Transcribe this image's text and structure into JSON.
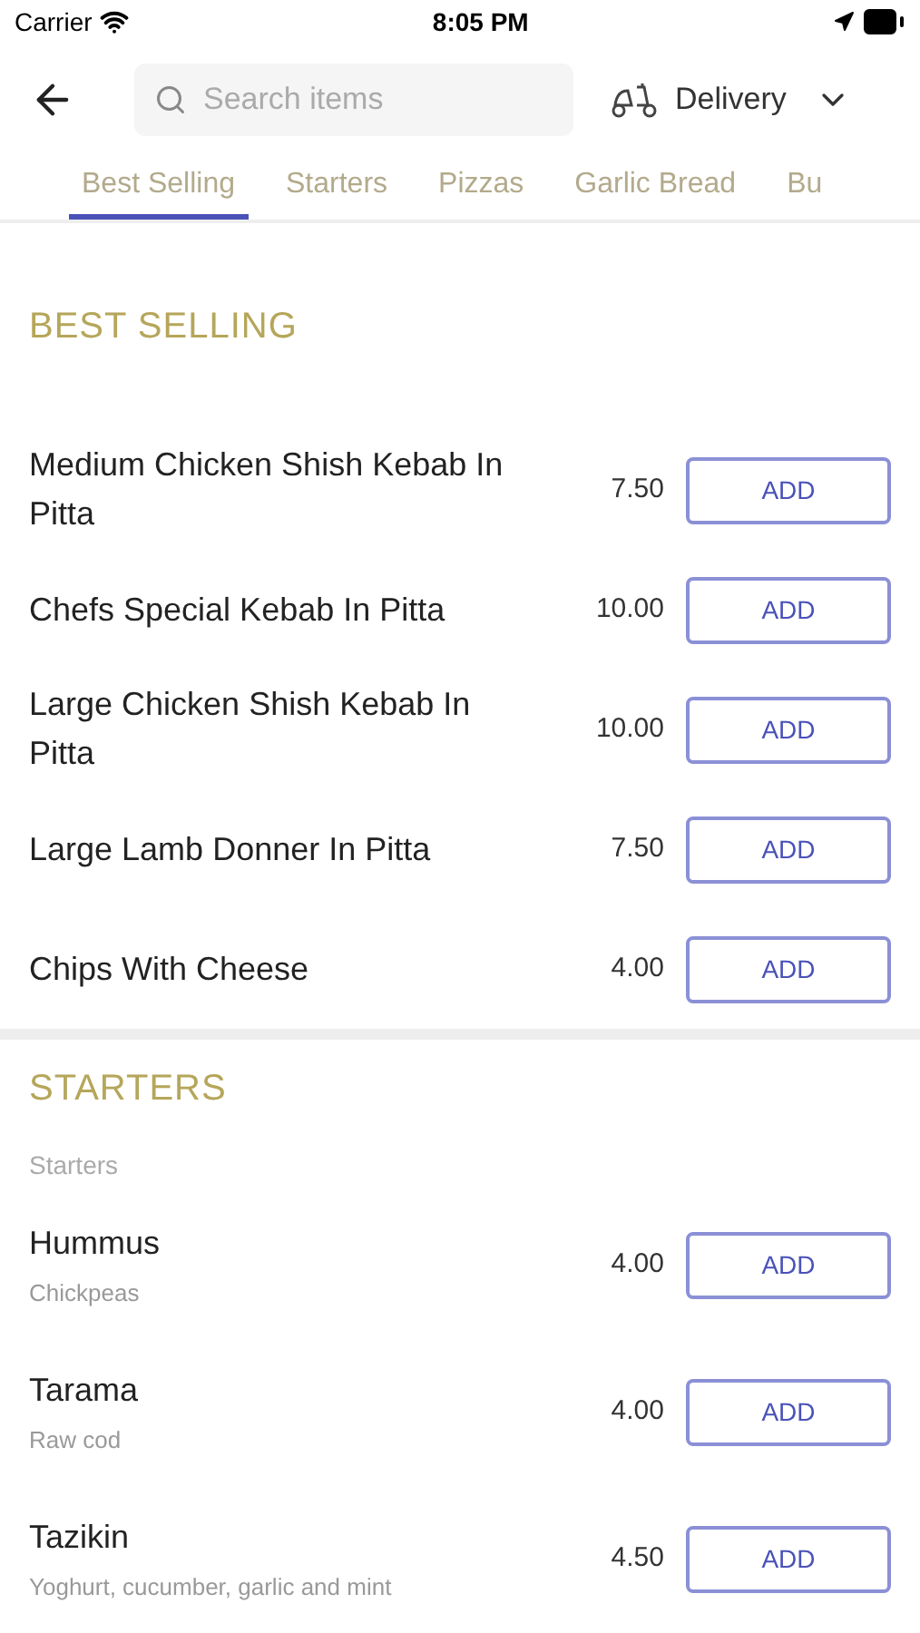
{
  "status_bar": {
    "carrier": "Carrier",
    "time": "8:05 PM"
  },
  "search": {
    "placeholder": "Search items"
  },
  "order_mode": {
    "label": "Delivery"
  },
  "tabs": [
    {
      "label": "Best Selling",
      "selected": true
    },
    {
      "label": "Starters",
      "selected": false
    },
    {
      "label": "Pizzas",
      "selected": false
    },
    {
      "label": "Garlic Bread",
      "selected": false
    },
    {
      "label": "Bu",
      "selected": false
    }
  ],
  "sections": [
    {
      "title": "BEST SELLING",
      "items": [
        {
          "name": "Medium Chicken Shish Kebab In Pitta",
          "price": "7.50",
          "button": "ADD"
        },
        {
          "name": "Chefs Special Kebab In Pitta",
          "price": "10.00",
          "button": "ADD"
        },
        {
          "name": "Large Chicken Shish Kebab In Pitta",
          "price": "10.00",
          "button": "ADD"
        },
        {
          "name": "Large Lamb Donner In Pitta",
          "price": "7.50",
          "button": "ADD"
        },
        {
          "name": "Chips With Cheese",
          "price": "4.00",
          "button": "ADD"
        }
      ]
    },
    {
      "title": "STARTERS",
      "subtitle": "Starters",
      "items": [
        {
          "name": "Hummus",
          "description": "Chickpeas",
          "price": "4.00",
          "button": "ADD"
        },
        {
          "name": "Tarama",
          "description": "Raw cod",
          "price": "4.00",
          "button": "ADD"
        },
        {
          "name": "Tazikin",
          "description": "Yoghurt, cucumber, garlic and mint",
          "price": "4.50",
          "button": "ADD"
        }
      ]
    }
  ]
}
